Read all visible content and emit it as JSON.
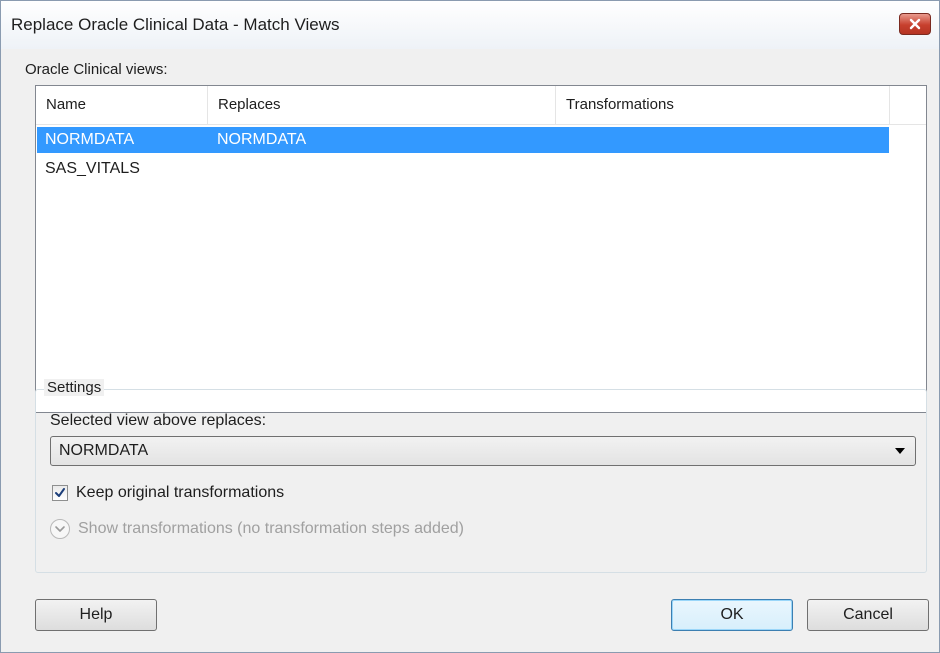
{
  "window": {
    "title": "Replace Oracle Clinical Data - Match Views",
    "close_icon": "close-x-icon"
  },
  "views": {
    "label": "Oracle Clinical views:",
    "columns": [
      "Name",
      "Replaces",
      "Transformations"
    ],
    "rows": [
      {
        "name": "NORMDATA",
        "replaces": "NORMDATA",
        "transformations": "",
        "selected": true
      },
      {
        "name": "SAS_VITALS",
        "replaces": "",
        "transformations": "",
        "selected": false
      }
    ]
  },
  "settings": {
    "group_label": "Settings",
    "selected_label": "Selected view above replaces:",
    "selected_value": "NORMDATA",
    "keep_checkbox_label": "Keep original transformations",
    "keep_checked": true,
    "show_transformations_label": "Show transformations (no transformation steps added)"
  },
  "buttons": {
    "help": "Help",
    "ok": "OK",
    "cancel": "Cancel"
  },
  "colors": {
    "selection": "#3399ff",
    "close_button": "#c7402e",
    "disabled_text": "#a0a0a0"
  }
}
